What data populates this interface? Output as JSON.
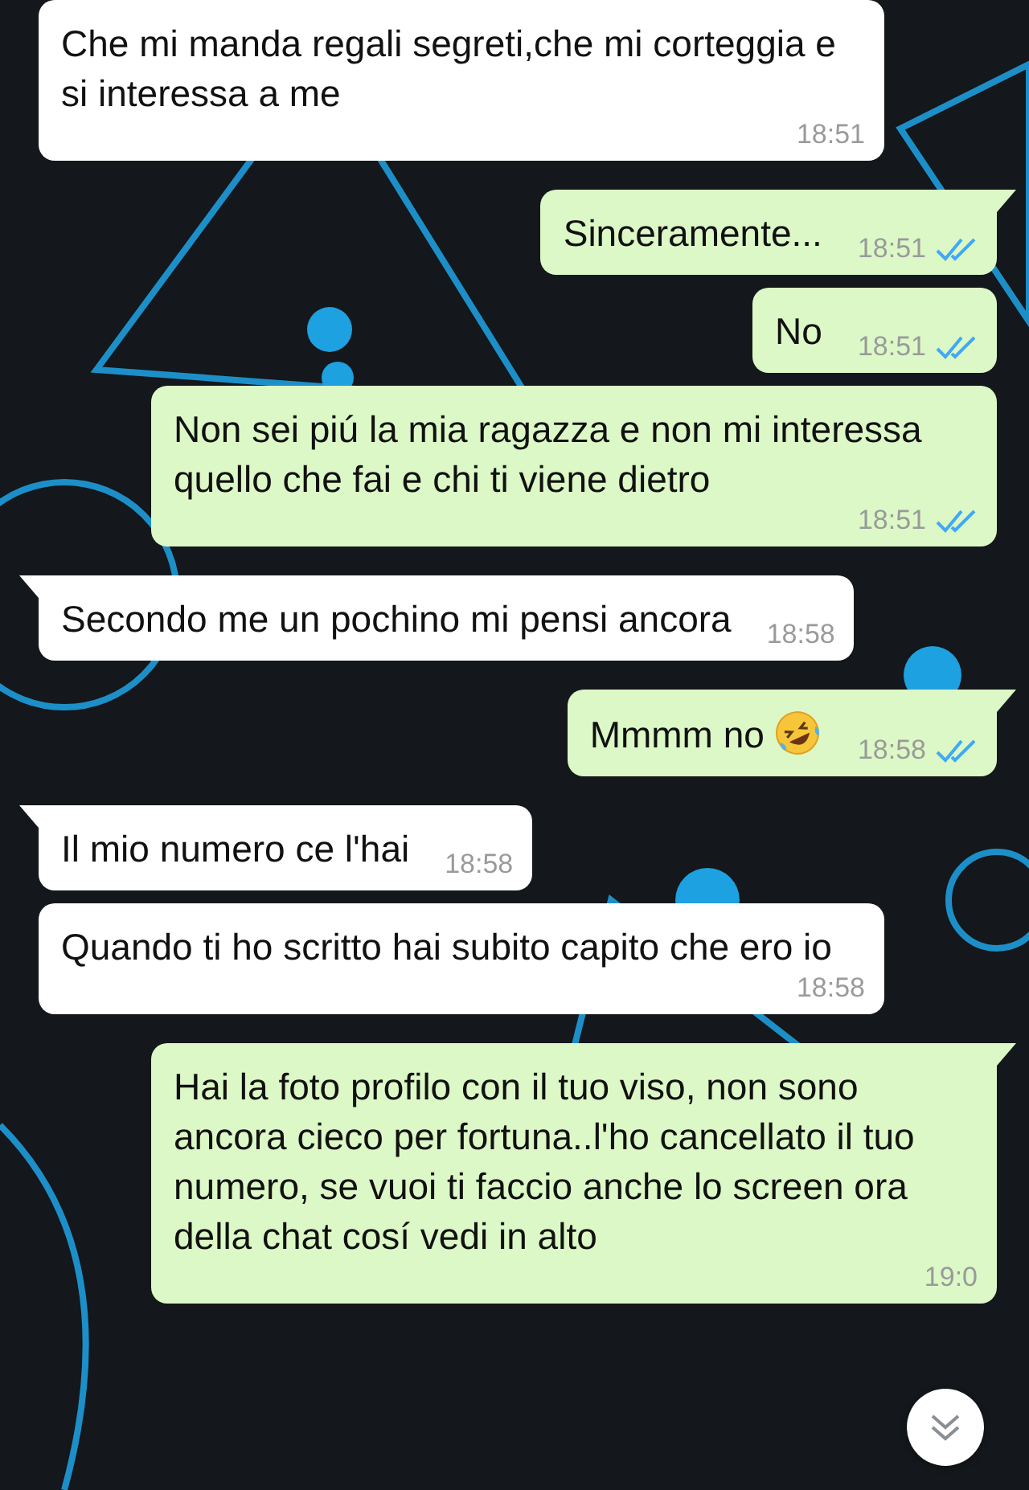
{
  "messages": [
    {
      "kind": "in",
      "tail": false,
      "text": "Che mi manda regali segreti,che mi corteggia e si interessa a me",
      "time": "18:51"
    },
    {
      "kind": "out",
      "tail": true,
      "text": "Sinceramente...",
      "time": "18:51",
      "read": true
    },
    {
      "kind": "out",
      "tail": false,
      "text": "No",
      "time": "18:51",
      "read": true
    },
    {
      "kind": "out",
      "tail": false,
      "text": "Non sei piú la mia ragazza e non mi interessa quello che fai e chi ti viene dietro",
      "time": "18:51",
      "read": true
    },
    {
      "kind": "in",
      "tail": true,
      "text": "Secondo me un pochino mi pensi ancora",
      "time": "18:58"
    },
    {
      "kind": "out",
      "tail": true,
      "text": "Mmmm no",
      "emoji": true,
      "time": "18:58",
      "read": true
    },
    {
      "kind": "in",
      "tail": true,
      "text": "Il mio numero ce l'hai",
      "time": "18:58"
    },
    {
      "kind": "in",
      "tail": false,
      "text": "Quando ti ho scritto hai subito capito che ero io",
      "time": "18:58"
    },
    {
      "kind": "out",
      "tail": true,
      "text": "Hai la foto profilo con il tuo viso, non sono ancora cieco per fortuna..l'ho cancellato il tuo numero, se vuoi ti faccio anche lo screen ora della chat cosí vedi in alto",
      "time": "19:0"
    }
  ],
  "scroll_down_button": {
    "visible": true
  }
}
